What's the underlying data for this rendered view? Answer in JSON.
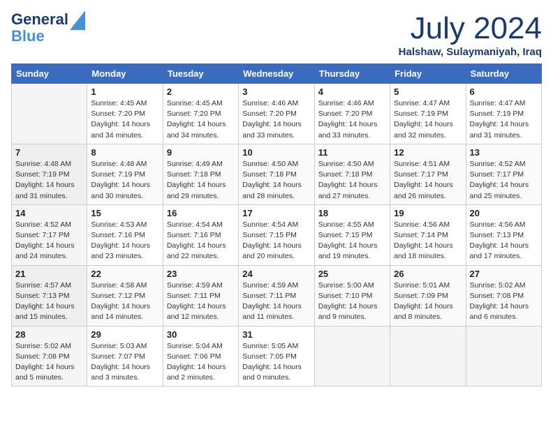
{
  "header": {
    "logo_line1": "General",
    "logo_line2": "Blue",
    "month_year": "July 2024",
    "location": "Halshaw, Sulaymaniyah, Iraq"
  },
  "days_of_week": [
    "Sunday",
    "Monday",
    "Tuesday",
    "Wednesday",
    "Thursday",
    "Friday",
    "Saturday"
  ],
  "weeks": [
    [
      {
        "day": "",
        "sunrise": "",
        "sunset": "",
        "daylight": ""
      },
      {
        "day": "1",
        "sunrise": "Sunrise: 4:45 AM",
        "sunset": "Sunset: 7:20 PM",
        "daylight": "Daylight: 14 hours and 34 minutes."
      },
      {
        "day": "2",
        "sunrise": "Sunrise: 4:45 AM",
        "sunset": "Sunset: 7:20 PM",
        "daylight": "Daylight: 14 hours and 34 minutes."
      },
      {
        "day": "3",
        "sunrise": "Sunrise: 4:46 AM",
        "sunset": "Sunset: 7:20 PM",
        "daylight": "Daylight: 14 hours and 33 minutes."
      },
      {
        "day": "4",
        "sunrise": "Sunrise: 4:46 AM",
        "sunset": "Sunset: 7:20 PM",
        "daylight": "Daylight: 14 hours and 33 minutes."
      },
      {
        "day": "5",
        "sunrise": "Sunrise: 4:47 AM",
        "sunset": "Sunset: 7:19 PM",
        "daylight": "Daylight: 14 hours and 32 minutes."
      },
      {
        "day": "6",
        "sunrise": "Sunrise: 4:47 AM",
        "sunset": "Sunset: 7:19 PM",
        "daylight": "Daylight: 14 hours and 31 minutes."
      }
    ],
    [
      {
        "day": "7",
        "sunrise": "Sunrise: 4:48 AM",
        "sunset": "Sunset: 7:19 PM",
        "daylight": "Daylight: 14 hours and 31 minutes."
      },
      {
        "day": "8",
        "sunrise": "Sunrise: 4:48 AM",
        "sunset": "Sunset: 7:19 PM",
        "daylight": "Daylight: 14 hours and 30 minutes."
      },
      {
        "day": "9",
        "sunrise": "Sunrise: 4:49 AM",
        "sunset": "Sunset: 7:18 PM",
        "daylight": "Daylight: 14 hours and 29 minutes."
      },
      {
        "day": "10",
        "sunrise": "Sunrise: 4:50 AM",
        "sunset": "Sunset: 7:18 PM",
        "daylight": "Daylight: 14 hours and 28 minutes."
      },
      {
        "day": "11",
        "sunrise": "Sunrise: 4:50 AM",
        "sunset": "Sunset: 7:18 PM",
        "daylight": "Daylight: 14 hours and 27 minutes."
      },
      {
        "day": "12",
        "sunrise": "Sunrise: 4:51 AM",
        "sunset": "Sunset: 7:17 PM",
        "daylight": "Daylight: 14 hours and 26 minutes."
      },
      {
        "day": "13",
        "sunrise": "Sunrise: 4:52 AM",
        "sunset": "Sunset: 7:17 PM",
        "daylight": "Daylight: 14 hours and 25 minutes."
      }
    ],
    [
      {
        "day": "14",
        "sunrise": "Sunrise: 4:52 AM",
        "sunset": "Sunset: 7:17 PM",
        "daylight": "Daylight: 14 hours and 24 minutes."
      },
      {
        "day": "15",
        "sunrise": "Sunrise: 4:53 AM",
        "sunset": "Sunset: 7:16 PM",
        "daylight": "Daylight: 14 hours and 23 minutes."
      },
      {
        "day": "16",
        "sunrise": "Sunrise: 4:54 AM",
        "sunset": "Sunset: 7:16 PM",
        "daylight": "Daylight: 14 hours and 22 minutes."
      },
      {
        "day": "17",
        "sunrise": "Sunrise: 4:54 AM",
        "sunset": "Sunset: 7:15 PM",
        "daylight": "Daylight: 14 hours and 20 minutes."
      },
      {
        "day": "18",
        "sunrise": "Sunrise: 4:55 AM",
        "sunset": "Sunset: 7:15 PM",
        "daylight": "Daylight: 14 hours and 19 minutes."
      },
      {
        "day": "19",
        "sunrise": "Sunrise: 4:56 AM",
        "sunset": "Sunset: 7:14 PM",
        "daylight": "Daylight: 14 hours and 18 minutes."
      },
      {
        "day": "20",
        "sunrise": "Sunrise: 4:56 AM",
        "sunset": "Sunset: 7:13 PM",
        "daylight": "Daylight: 14 hours and 17 minutes."
      }
    ],
    [
      {
        "day": "21",
        "sunrise": "Sunrise: 4:57 AM",
        "sunset": "Sunset: 7:13 PM",
        "daylight": "Daylight: 14 hours and 15 minutes."
      },
      {
        "day": "22",
        "sunrise": "Sunrise: 4:58 AM",
        "sunset": "Sunset: 7:12 PM",
        "daylight": "Daylight: 14 hours and 14 minutes."
      },
      {
        "day": "23",
        "sunrise": "Sunrise: 4:59 AM",
        "sunset": "Sunset: 7:11 PM",
        "daylight": "Daylight: 14 hours and 12 minutes."
      },
      {
        "day": "24",
        "sunrise": "Sunrise: 4:59 AM",
        "sunset": "Sunset: 7:11 PM",
        "daylight": "Daylight: 14 hours and 11 minutes."
      },
      {
        "day": "25",
        "sunrise": "Sunrise: 5:00 AM",
        "sunset": "Sunset: 7:10 PM",
        "daylight": "Daylight: 14 hours and 9 minutes."
      },
      {
        "day": "26",
        "sunrise": "Sunrise: 5:01 AM",
        "sunset": "Sunset: 7:09 PM",
        "daylight": "Daylight: 14 hours and 8 minutes."
      },
      {
        "day": "27",
        "sunrise": "Sunrise: 5:02 AM",
        "sunset": "Sunset: 7:08 PM",
        "daylight": "Daylight: 14 hours and 6 minutes."
      }
    ],
    [
      {
        "day": "28",
        "sunrise": "Sunrise: 5:02 AM",
        "sunset": "Sunset: 7:08 PM",
        "daylight": "Daylight: 14 hours and 5 minutes."
      },
      {
        "day": "29",
        "sunrise": "Sunrise: 5:03 AM",
        "sunset": "Sunset: 7:07 PM",
        "daylight": "Daylight: 14 hours and 3 minutes."
      },
      {
        "day": "30",
        "sunrise": "Sunrise: 5:04 AM",
        "sunset": "Sunset: 7:06 PM",
        "daylight": "Daylight: 14 hours and 2 minutes."
      },
      {
        "day": "31",
        "sunrise": "Sunrise: 5:05 AM",
        "sunset": "Sunset: 7:05 PM",
        "daylight": "Daylight: 14 hours and 0 minutes."
      },
      {
        "day": "",
        "sunrise": "",
        "sunset": "",
        "daylight": ""
      },
      {
        "day": "",
        "sunrise": "",
        "sunset": "",
        "daylight": ""
      },
      {
        "day": "",
        "sunrise": "",
        "sunset": "",
        "daylight": ""
      }
    ]
  ]
}
